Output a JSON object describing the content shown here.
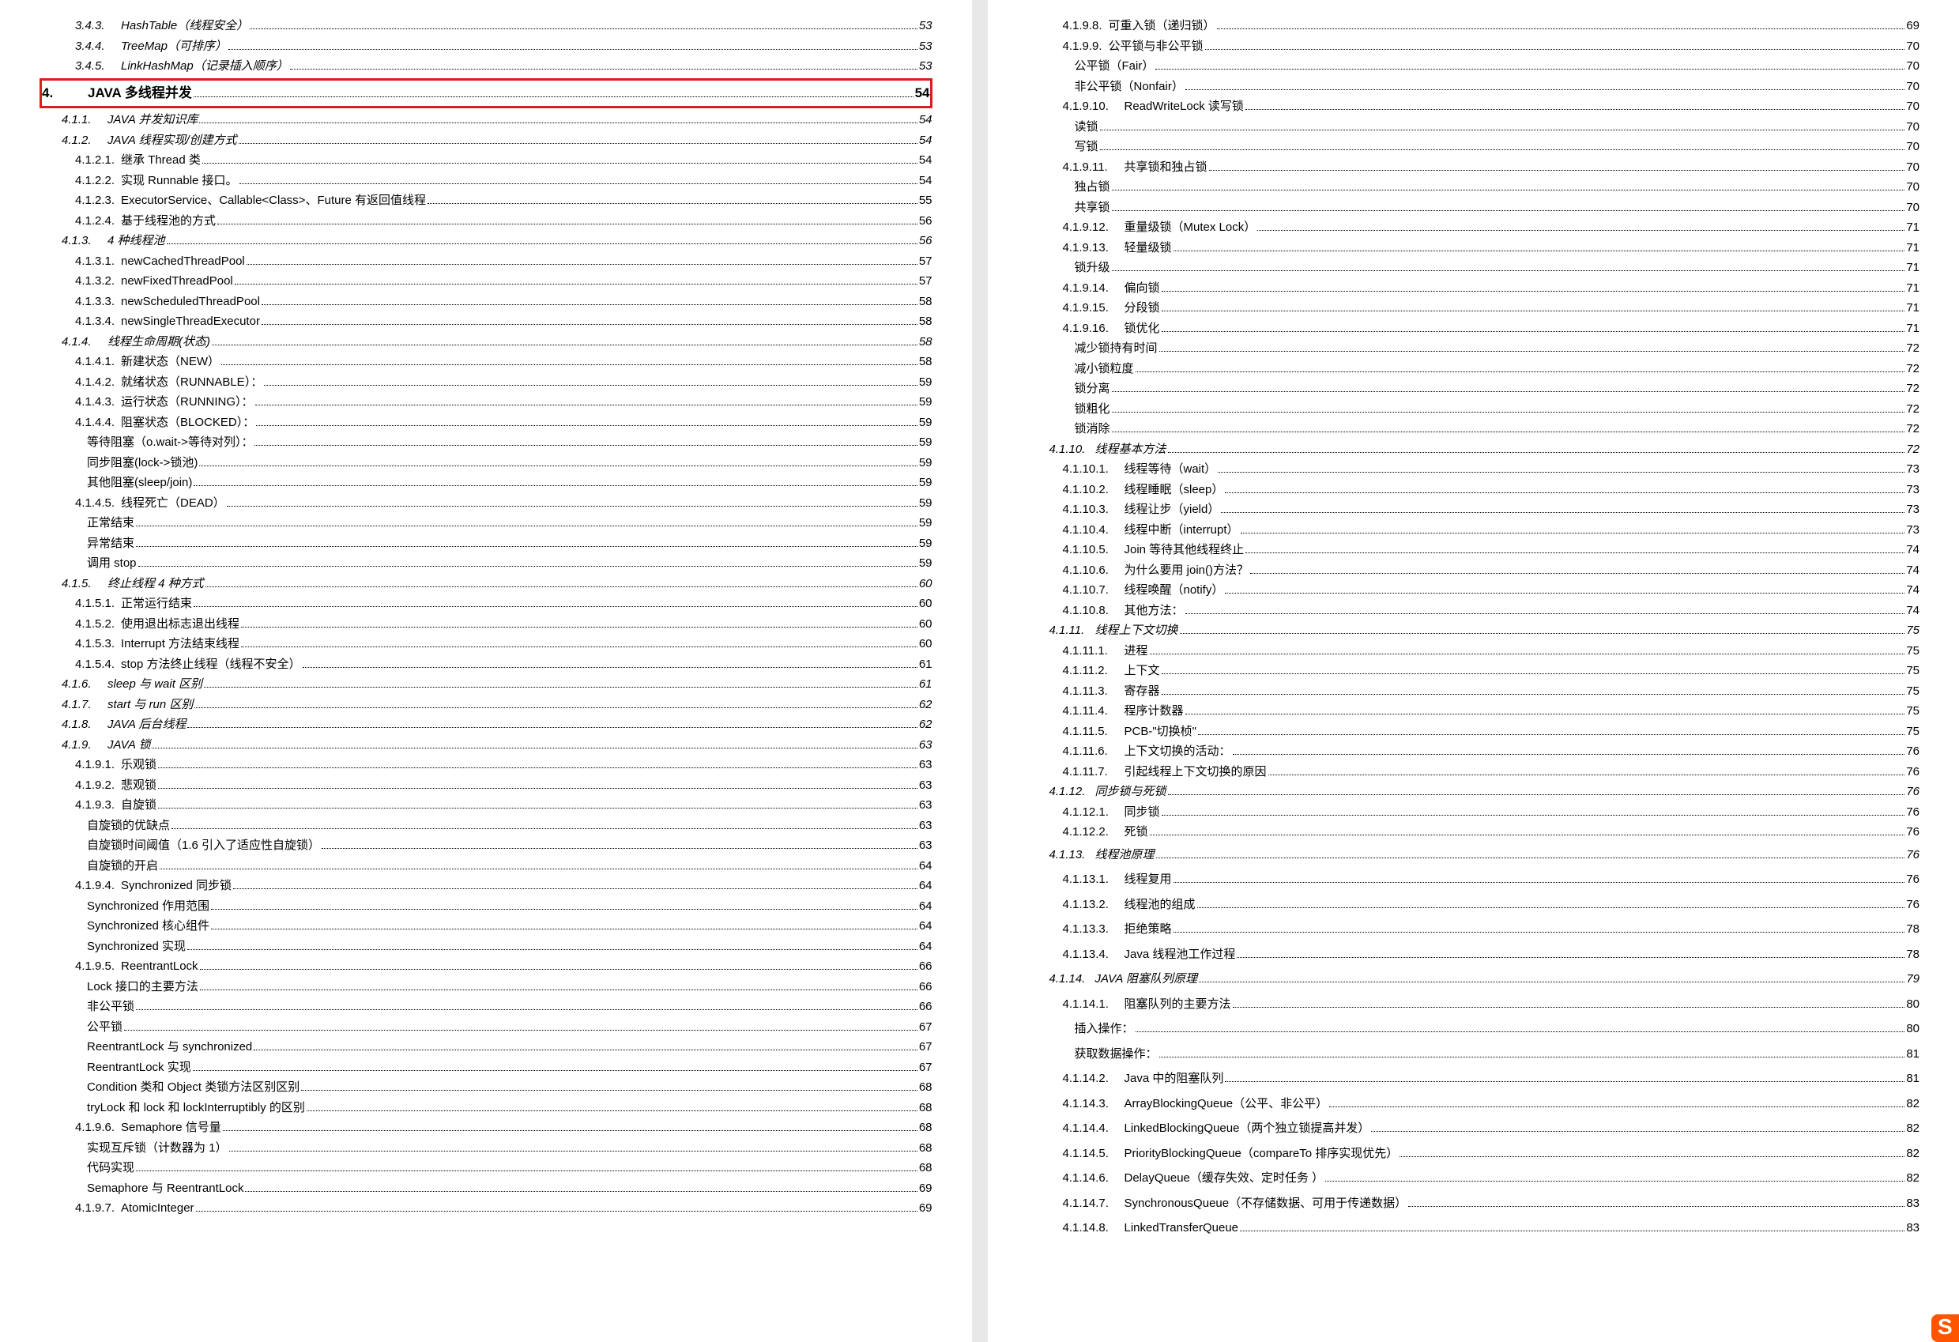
{
  "left": [
    {
      "lvl": 3,
      "n": "3.4.3.",
      "t": "HashTable（线程安全）",
      "p": "53",
      "i": true
    },
    {
      "lvl": 3,
      "n": "3.4.4.",
      "t": "TreeMap（可排序）",
      "p": "53",
      "i": true
    },
    {
      "lvl": 3,
      "n": "3.4.5.",
      "t": "LinkHashMap（记录插入顺序）",
      "p": "53",
      "i": true
    },
    {
      "type": "hl_start"
    },
    {
      "lvl": 0,
      "n": "4.",
      "t": "JAVA 多线程并发",
      "p": "54",
      "b": true
    },
    {
      "type": "hl_end"
    },
    {
      "lvl": 2,
      "n": "4.1.1.",
      "t": "JAVA 并发知识库",
      "p": "54",
      "i": true
    },
    {
      "lvl": 2,
      "n": "4.1.2.",
      "t": "JAVA 线程实现/创建方式",
      "p": "54",
      "i": true
    },
    {
      "lvl": 3,
      "n": "4.1.2.1.",
      "t": "继承 Thread 类",
      "p": "54"
    },
    {
      "lvl": 3,
      "n": "4.1.2.2.",
      "t": "实现 Runnable 接口。",
      "p": "54"
    },
    {
      "lvl": 3,
      "n": "4.1.2.3.",
      "t": "ExecutorService、Callable<Class>、Future 有返回值线程",
      "p": "55"
    },
    {
      "lvl": 3,
      "n": "4.1.2.4.",
      "t": "基于线程池的方式",
      "p": "56"
    },
    {
      "lvl": 2,
      "n": "4.1.3.",
      "t": "4 种线程池",
      "p": "56",
      "i": true
    },
    {
      "lvl": 3,
      "n": "4.1.3.1.",
      "t": "newCachedThreadPool",
      "p": "57"
    },
    {
      "lvl": 3,
      "n": "4.1.3.2.",
      "t": "newFixedThreadPool",
      "p": "57"
    },
    {
      "lvl": 3,
      "n": "4.1.3.3.",
      "t": "newScheduledThreadPool",
      "p": "58"
    },
    {
      "lvl": 3,
      "n": "4.1.3.4.",
      "t": "newSingleThreadExecutor",
      "p": "58"
    },
    {
      "lvl": 2,
      "n": "4.1.4.",
      "t": "线程生命周期(状态)",
      "p": "58",
      "i": true
    },
    {
      "lvl": 3,
      "n": "4.1.4.1.",
      "t": "新建状态（NEW）",
      "p": "58"
    },
    {
      "lvl": 3,
      "n": "4.1.4.2.",
      "t": "就绪状态（RUNNABLE）：",
      "p": "59"
    },
    {
      "lvl": 3,
      "n": "4.1.4.3.",
      "t": "运行状态（RUNNING）：",
      "p": "59"
    },
    {
      "lvl": 3,
      "n": "4.1.4.4.",
      "t": "阻塞状态（BLOCKED）：",
      "p": "59"
    },
    {
      "lvl": 4,
      "n": "",
      "t": "等待阻塞（o.wait->等待对列）：",
      "p": "59"
    },
    {
      "lvl": 4,
      "n": "",
      "t": "同步阻塞(lock->锁池)",
      "p": "59"
    },
    {
      "lvl": 4,
      "n": "",
      "t": "其他阻塞(sleep/join)",
      "p": "59"
    },
    {
      "lvl": 3,
      "n": "4.1.4.5.",
      "t": "线程死亡（DEAD）",
      "p": "59"
    },
    {
      "lvl": 4,
      "n": "",
      "t": "正常结束",
      "p": "59"
    },
    {
      "lvl": 4,
      "n": "",
      "t": "异常结束",
      "p": "59"
    },
    {
      "lvl": 4,
      "n": "",
      "t": "调用 stop",
      "p": "59"
    },
    {
      "lvl": 2,
      "n": "4.1.5.",
      "t": "终止线程 4 种方式",
      "p": "60",
      "i": true
    },
    {
      "lvl": 3,
      "n": "4.1.5.1.",
      "t": "正常运行结束",
      "p": "60"
    },
    {
      "lvl": 3,
      "n": "4.1.5.2.",
      "t": "使用退出标志退出线程",
      "p": "60"
    },
    {
      "lvl": 3,
      "n": "4.1.5.3.",
      "t": "Interrupt 方法结束线程",
      "p": "60"
    },
    {
      "lvl": 3,
      "n": "4.1.5.4.",
      "t": "stop 方法终止线程（线程不安全）",
      "p": "61"
    },
    {
      "lvl": 2,
      "n": "4.1.6.",
      "t": "sleep 与 wait 区别",
      "p": "61",
      "i": true
    },
    {
      "lvl": 2,
      "n": "4.1.7.",
      "t": "start 与 run 区别",
      "p": "62",
      "i": true
    },
    {
      "lvl": 2,
      "n": "4.1.8.",
      "t": "JAVA 后台线程",
      "p": "62",
      "i": true
    },
    {
      "lvl": 2,
      "n": "4.1.9.",
      "t": "JAVA 锁",
      "p": "63",
      "i": true
    },
    {
      "lvl": 3,
      "n": "4.1.9.1.",
      "t": "乐观锁",
      "p": "63"
    },
    {
      "lvl": 3,
      "n": "4.1.9.2.",
      "t": "悲观锁",
      "p": "63"
    },
    {
      "lvl": 3,
      "n": "4.1.9.3.",
      "t": "自旋锁",
      "p": "63"
    },
    {
      "lvl": 4,
      "n": "",
      "t": "自旋锁的优缺点",
      "p": "63"
    },
    {
      "lvl": 4,
      "n": "",
      "t": "自旋锁时间阈值（1.6 引入了适应性自旋锁）",
      "p": "63"
    },
    {
      "lvl": 4,
      "n": "",
      "t": "自旋锁的开启",
      "p": "64"
    },
    {
      "lvl": 3,
      "n": "4.1.9.4.",
      "t": "Synchronized 同步锁",
      "p": "64"
    },
    {
      "lvl": 4,
      "n": "",
      "t": "Synchronized 作用范围",
      "p": "64"
    },
    {
      "lvl": 4,
      "n": "",
      "t": "Synchronized 核心组件",
      "p": "64"
    },
    {
      "lvl": 4,
      "n": "",
      "t": "Synchronized 实现",
      "p": "64"
    },
    {
      "lvl": 3,
      "n": "4.1.9.5.",
      "t": "ReentrantLock",
      "p": "66"
    },
    {
      "lvl": 4,
      "n": "",
      "t": "Lock 接口的主要方法",
      "p": "66"
    },
    {
      "lvl": 4,
      "n": "",
      "t": "非公平锁",
      "p": "66"
    },
    {
      "lvl": 4,
      "n": "",
      "t": "公平锁",
      "p": "67"
    },
    {
      "lvl": 4,
      "n": "",
      "t": "ReentrantLock 与 synchronized",
      "p": "67"
    },
    {
      "lvl": 4,
      "n": "",
      "t": "ReentrantLock 实现",
      "p": "67"
    },
    {
      "lvl": 4,
      "n": "",
      "t": "Condition 类和 Object 类锁方法区别区别",
      "p": "68"
    },
    {
      "lvl": 4,
      "n": "",
      "t": "tryLock 和 lock 和 lockInterruptibly 的区别",
      "p": "68"
    },
    {
      "lvl": 3,
      "n": "4.1.9.6.",
      "t": "Semaphore 信号量",
      "p": "68"
    },
    {
      "lvl": 4,
      "n": "",
      "t": "实现互斥锁（计数器为 1）",
      "p": "68"
    },
    {
      "lvl": 4,
      "n": "",
      "t": "代码实现",
      "p": "68"
    },
    {
      "lvl": 4,
      "n": "",
      "t": "Semaphore 与 ReentrantLock",
      "p": "69"
    },
    {
      "lvl": 3,
      "n": "4.1.9.7.",
      "t": "AtomicInteger",
      "p": "69"
    }
  ],
  "right": [
    {
      "lvl": 3,
      "n": "4.1.9.8.",
      "t": "可重入锁（递归锁）",
      "p": "69"
    },
    {
      "lvl": 3,
      "n": "4.1.9.9.",
      "t": "公平锁与非公平锁",
      "p": "70"
    },
    {
      "lvl": 4,
      "n": "",
      "t": "公平锁（Fair）",
      "p": "70"
    },
    {
      "lvl": 4,
      "n": "",
      "t": "非公平锁（Nonfair）",
      "p": "70"
    },
    {
      "lvl": 3,
      "n": "4.1.9.10.",
      "t": "ReadWriteLock 读写锁",
      "p": "70",
      "w": true
    },
    {
      "lvl": 4,
      "n": "",
      "t": "读锁",
      "p": "70"
    },
    {
      "lvl": 4,
      "n": "",
      "t": "写锁",
      "p": "70"
    },
    {
      "lvl": 3,
      "n": "4.1.9.11.",
      "t": "共享锁和独占锁",
      "p": "70",
      "w": true
    },
    {
      "lvl": 4,
      "n": "",
      "t": "独占锁",
      "p": "70"
    },
    {
      "lvl": 4,
      "n": "",
      "t": "共享锁",
      "p": "70"
    },
    {
      "lvl": 3,
      "n": "4.1.9.12.",
      "t": "重量级锁（Mutex Lock）",
      "p": "71",
      "w": true
    },
    {
      "lvl": 3,
      "n": "4.1.9.13.",
      "t": "轻量级锁",
      "p": "71",
      "w": true
    },
    {
      "lvl": 4,
      "n": "",
      "t": "锁升级",
      "p": "71"
    },
    {
      "lvl": 3,
      "n": "4.1.9.14.",
      "t": "偏向锁",
      "p": "71",
      "w": true
    },
    {
      "lvl": 3,
      "n": "4.1.9.15.",
      "t": "分段锁",
      "p": "71",
      "w": true
    },
    {
      "lvl": 3,
      "n": "4.1.9.16.",
      "t": "锁优化",
      "p": "71",
      "w": true
    },
    {
      "lvl": 4,
      "n": "",
      "t": "减少锁持有时间",
      "p": "72"
    },
    {
      "lvl": 4,
      "n": "",
      "t": "减小锁粒度",
      "p": "72"
    },
    {
      "lvl": 4,
      "n": "",
      "t": "锁分离",
      "p": "72"
    },
    {
      "lvl": 4,
      "n": "",
      "t": "锁粗化",
      "p": "72"
    },
    {
      "lvl": 4,
      "n": "",
      "t": "锁消除",
      "p": "72"
    },
    {
      "lvl": 2,
      "n": "4.1.10.",
      "t": "线程基本方法",
      "p": "72",
      "i": true
    },
    {
      "lvl": 3,
      "n": "4.1.10.1.",
      "t": "线程等待（wait）",
      "p": "73",
      "w": true
    },
    {
      "lvl": 3,
      "n": "4.1.10.2.",
      "t": "线程睡眠（sleep）",
      "p": "73",
      "w": true
    },
    {
      "lvl": 3,
      "n": "4.1.10.3.",
      "t": "线程让步（yield）",
      "p": "73",
      "w": true
    },
    {
      "lvl": 3,
      "n": "4.1.10.4.",
      "t": "线程中断（interrupt）",
      "p": "73",
      "w": true
    },
    {
      "lvl": 3,
      "n": "4.1.10.5.",
      "t": "Join 等待其他线程终止",
      "p": "74",
      "w": true
    },
    {
      "lvl": 3,
      "n": "4.1.10.6.",
      "t": "为什么要用 join()方法？",
      "p": "74",
      "w": true
    },
    {
      "lvl": 3,
      "n": "4.1.10.7.",
      "t": "线程唤醒（notify）",
      "p": "74",
      "w": true
    },
    {
      "lvl": 3,
      "n": "4.1.10.8.",
      "t": "其他方法：",
      "p": "74",
      "w": true
    },
    {
      "lvl": 2,
      "n": "4.1.11.",
      "t": "线程上下文切换",
      "p": "75",
      "i": true
    },
    {
      "lvl": 3,
      "n": "4.1.11.1.",
      "t": "进程",
      "p": "75",
      "w": true
    },
    {
      "lvl": 3,
      "n": "4.1.11.2.",
      "t": "上下文",
      "p": "75",
      "w": true
    },
    {
      "lvl": 3,
      "n": "4.1.11.3.",
      "t": "寄存器",
      "p": "75",
      "w": true
    },
    {
      "lvl": 3,
      "n": "4.1.11.4.",
      "t": "程序计数器",
      "p": "75",
      "w": true
    },
    {
      "lvl": 3,
      "n": "4.1.11.5.",
      "t": "PCB-\"切换桢\"",
      "p": "75",
      "w": true
    },
    {
      "lvl": 3,
      "n": "4.1.11.6.",
      "t": "上下文切换的活动：",
      "p": "76",
      "w": true
    },
    {
      "lvl": 3,
      "n": "4.1.11.7.",
      "t": "引起线程上下文切换的原因",
      "p": "76",
      "w": true
    },
    {
      "lvl": 2,
      "n": "4.1.12.",
      "t": "同步锁与死锁",
      "p": "76",
      "i": true
    },
    {
      "lvl": 3,
      "n": "4.1.12.1.",
      "t": "同步锁",
      "p": "76",
      "w": true
    },
    {
      "lvl": 3,
      "n": "4.1.12.2.",
      "t": "死锁",
      "p": "76",
      "w": true
    },
    {
      "lvl": 2,
      "n": "4.1.13.",
      "t": "线程池原理",
      "p": "76",
      "i": true
    },
    {
      "lvl": 3,
      "n": "4.1.13.1.",
      "t": "线程复用",
      "p": "76",
      "w": true
    },
    {
      "lvl": 3,
      "n": "4.1.13.2.",
      "t": "线程池的组成",
      "p": "76",
      "w": true
    },
    {
      "lvl": 3,
      "n": "4.1.13.3.",
      "t": "拒绝策略",
      "p": "78",
      "w": true
    },
    {
      "lvl": 3,
      "n": "4.1.13.4.",
      "t": "Java 线程池工作过程",
      "p": "78",
      "w": true
    },
    {
      "lvl": 2,
      "n": "4.1.14.",
      "t": "JAVA 阻塞队列原理",
      "p": "79",
      "i": true
    },
    {
      "lvl": 3,
      "n": "4.1.14.1.",
      "t": "阻塞队列的主要方法",
      "p": "80",
      "w": true
    },
    {
      "lvl": 4,
      "n": "",
      "t": "插入操作：",
      "p": "80"
    },
    {
      "lvl": 4,
      "n": "",
      "t": "获取数据操作：",
      "p": "81"
    },
    {
      "lvl": 3,
      "n": "4.1.14.2.",
      "t": "Java 中的阻塞队列",
      "p": "81",
      "w": true
    },
    {
      "lvl": 3,
      "n": "4.1.14.3.",
      "t": "ArrayBlockingQueue（公平、非公平）",
      "p": "82",
      "w": true
    },
    {
      "lvl": 3,
      "n": "4.1.14.4.",
      "t": "LinkedBlockingQueue（两个独立锁提高并发）",
      "p": "82",
      "w": true
    },
    {
      "lvl": 3,
      "n": "4.1.14.5.",
      "t": "PriorityBlockingQueue（compareTo 排序实现优先）",
      "p": "82",
      "w": true
    },
    {
      "lvl": 3,
      "n": "4.1.14.6.",
      "t": "DelayQueue（缓存失效、定时任务 ）",
      "p": "82",
      "w": true
    },
    {
      "lvl": 3,
      "n": "4.1.14.7.",
      "t": "SynchronousQueue（不存储数据、可用于传递数据）",
      "p": "83",
      "w": true
    },
    {
      "lvl": 3,
      "n": "4.1.14.8.",
      "t": "LinkedTransferQueue",
      "p": "83",
      "w": true
    }
  ]
}
